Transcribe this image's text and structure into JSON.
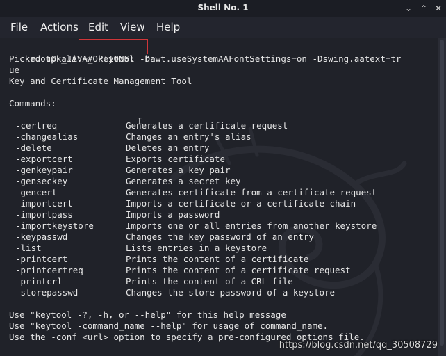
{
  "window": {
    "title": "Shell No. 1",
    "minimize_glyph": "⌄",
    "maximize_glyph": "⌃",
    "close_glyph": "✕"
  },
  "menu": [
    "File",
    "Actions",
    "Edit",
    "View",
    "Help"
  ],
  "terminal": {
    "prompt": "root@kali:~# ",
    "command": "keytool -h",
    "java_options_1": "Picked up _JAVA_OPTIONS: -Dawt.useSystemAAFontSettings=on -Dswing.aatext=tr",
    "java_options_2": "ue",
    "tool_title": "Key and Certificate Management Tool",
    "commands_header": "Commands:",
    "commands": [
      {
        "opt": "-certreq",
        "desc": "Generates a certificate request"
      },
      {
        "opt": "-changealias",
        "desc": "Changes an entry's alias"
      },
      {
        "opt": "-delete",
        "desc": "Deletes an entry"
      },
      {
        "opt": "-exportcert",
        "desc": "Exports certificate"
      },
      {
        "opt": "-genkeypair",
        "desc": "Generates a key pair"
      },
      {
        "opt": "-genseckey",
        "desc": "Generates a secret key"
      },
      {
        "opt": "-gencert",
        "desc": "Generates certificate from a certificate request"
      },
      {
        "opt": "-importcert",
        "desc": "Imports a certificate or a certificate chain"
      },
      {
        "opt": "-importpass",
        "desc": "Imports a password"
      },
      {
        "opt": "-importkeystore",
        "desc": "Imports one or all entries from another keystore"
      },
      {
        "opt": "-keypasswd",
        "desc": "Changes the key password of an entry"
      },
      {
        "opt": "-list",
        "desc": "Lists entries in a keystore"
      },
      {
        "opt": "-printcert",
        "desc": "Prints the content of a certificate"
      },
      {
        "opt": "-printcertreq",
        "desc": "Prints the content of a certificate request"
      },
      {
        "opt": "-printcrl",
        "desc": "Prints the content of a CRL file"
      },
      {
        "opt": "-storepasswd",
        "desc": "Changes the store password of a keystore"
      }
    ],
    "help_1": "Use \"keytool -?, -h, or --help\" for this help message",
    "help_2": "Use \"keytool -command_name --help\" for usage of command_name.",
    "help_3": "Use the -conf <url> option to specify a pre-configured options file."
  },
  "watermark_text": "https://blog.csdn.net/qq_30508729",
  "colors": {
    "background": "#23252e",
    "text": "#e6e6e6",
    "highlight_box": "#d0363a"
  }
}
